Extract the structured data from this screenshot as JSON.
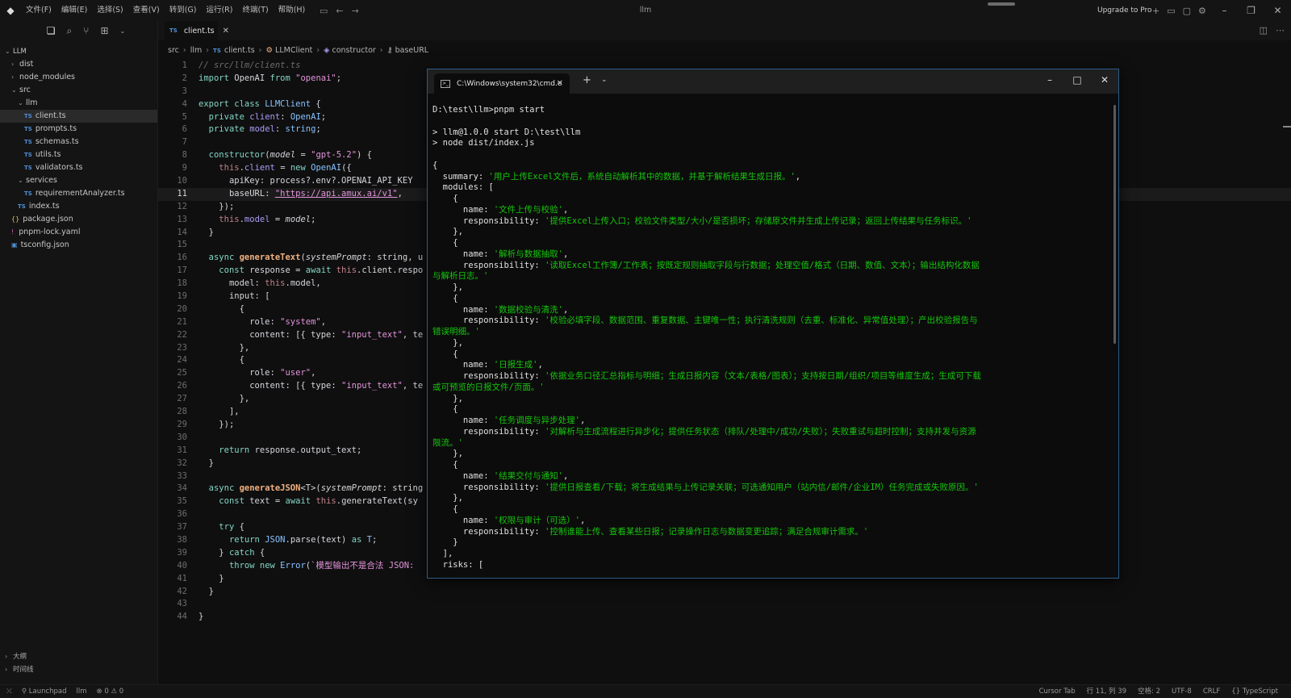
{
  "window": {
    "title": "llm",
    "menu": [
      "文件(F)",
      "编辑(E)",
      "选择(S)",
      "查看(V)",
      "转到(G)",
      "运行(R)",
      "终端(T)",
      "帮助(H)"
    ],
    "upgrade_label": "Upgrade to Pro"
  },
  "explorer": {
    "root": "LLM",
    "items": [
      {
        "label": "dist",
        "type": "folder",
        "expanded": false,
        "depth": 1
      },
      {
        "label": "node_modules",
        "type": "folder",
        "expanded": false,
        "depth": 1
      },
      {
        "label": "src",
        "type": "folder",
        "expanded": true,
        "depth": 1
      },
      {
        "label": "llm",
        "type": "folder",
        "expanded": true,
        "depth": 2
      },
      {
        "label": "client.ts",
        "type": "ts",
        "depth": 3,
        "selected": true
      },
      {
        "label": "prompts.ts",
        "type": "ts",
        "depth": 3
      },
      {
        "label": "schemas.ts",
        "type": "ts",
        "depth": 3
      },
      {
        "label": "utils.ts",
        "type": "ts",
        "depth": 3
      },
      {
        "label": "validators.ts",
        "type": "ts",
        "depth": 3
      },
      {
        "label": "services",
        "type": "folder",
        "expanded": true,
        "depth": 2
      },
      {
        "label": "requirementAnalyzer.ts",
        "type": "ts",
        "depth": 3
      },
      {
        "label": "index.ts",
        "type": "ts",
        "depth": 2
      },
      {
        "label": "package.json",
        "type": "json",
        "depth": 1
      },
      {
        "label": "pnpm-lock.yaml",
        "type": "yaml",
        "depth": 1
      },
      {
        "label": "tsconfig.json",
        "type": "tsconfig",
        "depth": 1
      }
    ],
    "bottom_sections": [
      "大纲",
      "时间线"
    ]
  },
  "editor": {
    "tab_label": "client.ts",
    "breadcrumb": [
      "src",
      "llm",
      "client.ts",
      "LLMClient",
      "constructor",
      "baseURL"
    ],
    "current_line": 11,
    "line_count": 44
  },
  "terminal": {
    "tab_title": "C:\\Windows\\system32\\cmd.e",
    "lines": [
      {
        "t": "D:\\test\\llm>pnpm start"
      },
      {
        "t": ""
      },
      {
        "t": "> llm@1.0.0 start D:\\test\\llm"
      },
      {
        "t": "> node dist/index.js"
      },
      {
        "t": ""
      },
      {
        "t": "{"
      },
      {
        "t": "  summary: ",
        "g": "'用户上传Excel文件后，系统自动解析其中的数据，并基于解析结果生成日报。'",
        "e": ","
      },
      {
        "t": "  modules: ["
      },
      {
        "t": "    {"
      },
      {
        "t": "      name: ",
        "g": "'文件上传与校验'",
        "e": ","
      },
      {
        "t": "      responsibility: ",
        "g": "'提供Excel上传入口；校验文件类型/大小/是否损坏；存储原文件并生成上传记录；返回上传结果与任务标识。'"
      },
      {
        "t": "    },"
      },
      {
        "t": "    {"
      },
      {
        "t": "      name: ",
        "g": "'解析与数据抽取'",
        "e": ","
      },
      {
        "t": "      responsibility: ",
        "g": "'读取Excel工作簿/工作表；按既定规则抽取字段与行数据；处理空值/格式（日期、数值、文本）；输出结构化数据"
      },
      {
        "t": "",
        "g": "与解析日志。'"
      },
      {
        "t": "    },"
      },
      {
        "t": "    {"
      },
      {
        "t": "      name: ",
        "g": "'数据校验与清洗'",
        "e": ","
      },
      {
        "t": "      responsibility: ",
        "g": "'校验必填字段、数据范围、重复数据、主键唯一性；执行清洗规则（去重、标准化、异常值处理）；产出校验报告与"
      },
      {
        "t": "",
        "g": "错误明细。'"
      },
      {
        "t": "    },"
      },
      {
        "t": "    {"
      },
      {
        "t": "      name: ",
        "g": "'日报生成'",
        "e": ","
      },
      {
        "t": "      responsibility: ",
        "g": "'依据业务口径汇总指标与明细；生成日报内容（文本/表格/图表）；支持按日期/组织/项目等维度生成；生成可下载"
      },
      {
        "t": "",
        "g": "或可预览的日报文件/页面。'"
      },
      {
        "t": "    },"
      },
      {
        "t": "    {"
      },
      {
        "t": "      name: ",
        "g": "'任务调度与异步处理'",
        "e": ","
      },
      {
        "t": "      responsibility: ",
        "g": "'对解析与生成流程进行异步化；提供任务状态（排队/处理中/成功/失败）；失败重试与超时控制；支持并发与资源"
      },
      {
        "t": "",
        "g": "限流。'"
      },
      {
        "t": "    },"
      },
      {
        "t": "    {"
      },
      {
        "t": "      name: ",
        "g": "'结果交付与通知'",
        "e": ","
      },
      {
        "t": "      responsibility: ",
        "g": "'提供日报查看/下载；将生成结果与上传记录关联；可选通知用户（站内信/邮件/企业IM）任务完成或失败原因。'"
      },
      {
        "t": "    },"
      },
      {
        "t": "    {"
      },
      {
        "t": "      name: ",
        "g": "'权限与审计（可选）'",
        "e": ","
      },
      {
        "t": "      responsibility: ",
        "g": "'控制谁能上传、查看某些日报；记录操作日志与数据变更追踪；满足合规审计需求。'"
      },
      {
        "t": "    }"
      },
      {
        "t": "  ],"
      },
      {
        "t": "  risks: ["
      }
    ]
  },
  "statusbar": {
    "launchpad": "Launchpad",
    "project": "llm",
    "problems": "⊗ 0 ⚠ 0",
    "cursor_tab": "Cursor Tab",
    "position": "行 11, 列 39",
    "spaces": "空格: 2",
    "encoding": "UTF-8",
    "eol": "CRLF",
    "language": "{} TypeScript"
  }
}
